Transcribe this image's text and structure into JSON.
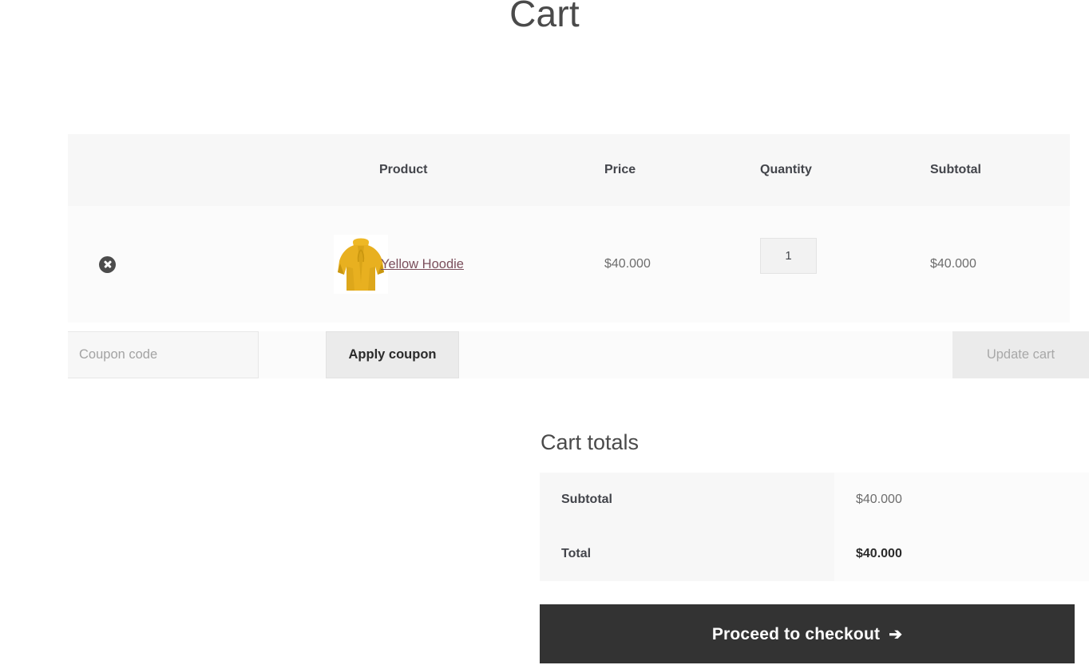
{
  "page": {
    "title": "Cart"
  },
  "cart_table": {
    "headers": {
      "remove": "",
      "thumbnail": "",
      "product": "Product",
      "price": "Price",
      "quantity": "Quantity",
      "subtotal": "Subtotal"
    },
    "rows": [
      {
        "remove_icon": "remove-circle-x-icon",
        "thumbnail_alt": "yellow-hoodie-thumbnail",
        "thumbnail_color": "#e8b020",
        "product_name": "Yellow Hoodie",
        "price": "$40.000",
        "quantity": "1",
        "subtotal": "$40.000"
      }
    ]
  },
  "actions": {
    "coupon_placeholder": "Coupon code",
    "coupon_value": "",
    "apply_coupon_label": "Apply coupon",
    "update_cart_label": "Update cart"
  },
  "cart_totals": {
    "heading": "Cart totals",
    "rows": [
      {
        "label": "Subtotal",
        "value": "$40.000"
      },
      {
        "label": "Total",
        "value": "$40.000"
      }
    ],
    "checkout_label": "Proceed to checkout",
    "checkout_arrow": "➔"
  },
  "colors": {
    "link": "#7b4f5c",
    "checkout_button_bg": "#333333",
    "header_bg": "#f7f7f7",
    "row_bg": "#fbfbfb",
    "remove_icon": "#4c4c4c",
    "product_image": "#e8b020"
  }
}
